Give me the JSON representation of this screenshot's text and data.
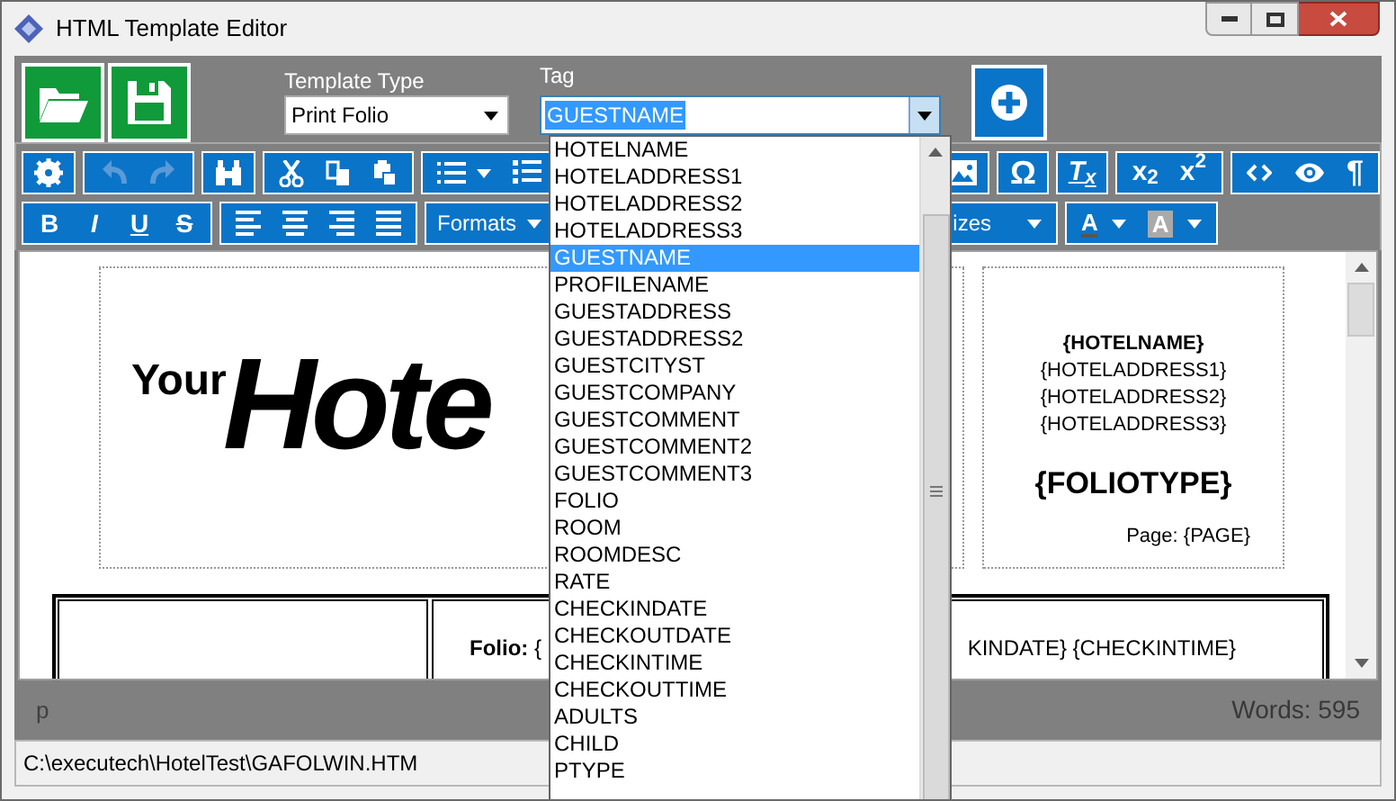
{
  "window": {
    "title": "HTML Template Editor"
  },
  "template_type": {
    "label": "Template Type",
    "value": "Print Folio"
  },
  "tag": {
    "label": "Tag",
    "value": "GUESTNAME",
    "expanded": true,
    "options": [
      {
        "label": "HOTELNAME",
        "selected": false
      },
      {
        "label": "HOTELADDRESS1",
        "selected": false
      },
      {
        "label": "HOTELADDRESS2",
        "selected": false
      },
      {
        "label": "HOTELADDRESS3",
        "selected": false
      },
      {
        "label": "GUESTNAME",
        "selected": true
      },
      {
        "label": "PROFILENAME",
        "selected": false
      },
      {
        "label": "GUESTADDRESS",
        "selected": false
      },
      {
        "label": "GUESTADDRESS2",
        "selected": false
      },
      {
        "label": "GUESTCITYST",
        "selected": false
      },
      {
        "label": "GUESTCOMPANY",
        "selected": false
      },
      {
        "label": "GUESTCOMMENT",
        "selected": false
      },
      {
        "label": "GUESTCOMMENT2",
        "selected": false
      },
      {
        "label": "GUESTCOMMENT3",
        "selected": false
      },
      {
        "label": "FOLIO",
        "selected": false
      },
      {
        "label": "ROOM",
        "selected": false
      },
      {
        "label": "ROOMDESC",
        "selected": false
      },
      {
        "label": "RATE",
        "selected": false
      },
      {
        "label": "CHECKINDATE",
        "selected": false
      },
      {
        "label": "CHECKOUTDATE",
        "selected": false
      },
      {
        "label": "CHECKINTIME",
        "selected": false
      },
      {
        "label": "CHECKOUTTIME",
        "selected": false
      },
      {
        "label": "ADULTS",
        "selected": false
      },
      {
        "label": "CHILD",
        "selected": false
      },
      {
        "label": "PTYPE",
        "selected": false
      }
    ]
  },
  "toolbar": {
    "undo": {
      "disabled": true
    },
    "redo": {
      "disabled": true
    },
    "special_character": "Ω",
    "clear_formatting": "T$_{x}$",
    "subscript": "x$_{2}$",
    "superscript": "x$^{2}$",
    "paragraph_marks": "¶",
    "format_buttons": [
      "B",
      "I",
      "U",
      "S"
    ],
    "formats": "Formats",
    "font_sizes": "izes",
    "font_color": "A",
    "background_color": "A"
  },
  "document": {
    "logo_small": "Your",
    "logo_script": "Hote",
    "hotel_lines": [
      "{HOTELNAME}",
      "{HOTELADDRESS1}",
      "{HOTELADDRESS2}",
      "{HOTELADDRESS3}"
    ],
    "folio_type": "{FOLIOTYPE}",
    "page": "Page: {PAGE}",
    "folio_line": "**Folio:** {",
    "folio_line_end": "KINDATE} {CHECKINTIME}"
  },
  "status_bar": {
    "element": "p",
    "words": "Words: 595"
  },
  "file_path": "C:\\executech\\HotelTest\\GAFOLWIN.HTM"
}
